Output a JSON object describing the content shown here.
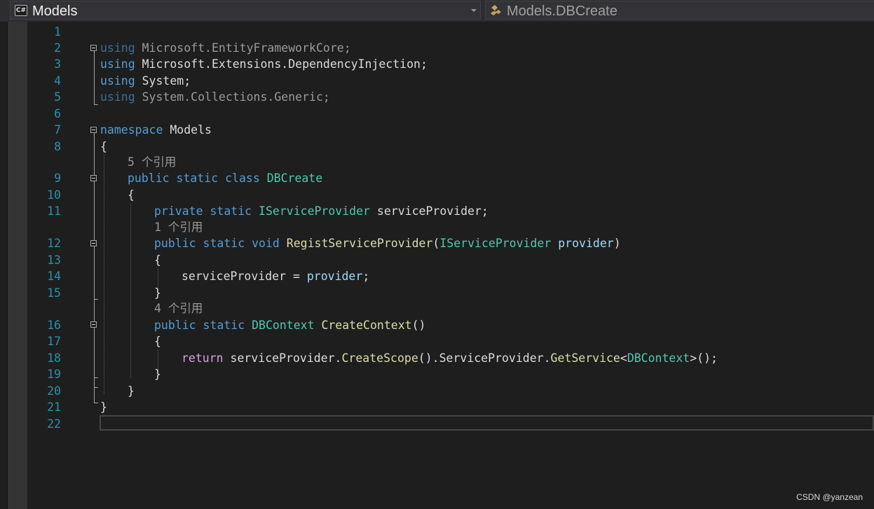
{
  "navbar": {
    "project_icon": "csharp-project-icon",
    "project": "Models",
    "type_icon": "class-icon",
    "type": "Models.DBCreate"
  },
  "editor": {
    "line_numbers": [
      "1",
      "2",
      "3",
      "4",
      "5",
      "6",
      "7",
      "8",
      "9",
      "10",
      "11",
      "12",
      "13",
      "14",
      "15",
      "16",
      "17",
      "18",
      "19",
      "20",
      "21",
      "22"
    ],
    "code": {
      "l2": {
        "kw": "using",
        "ns": "Microsoft.EntityFrameworkCore;"
      },
      "l3": {
        "kw": "using",
        "ns": "Microsoft.Extensions.DependencyInjection;"
      },
      "l4": {
        "kw": "using",
        "ns": "System;"
      },
      "l5": {
        "kw": "using",
        "ns": "System.Collections.Generic;"
      },
      "l7": {
        "kw": "namespace",
        "ns": "Models"
      },
      "l8": {
        "text": "{"
      },
      "lens1": {
        "count": "5",
        "label": "个引用"
      },
      "l9": {
        "kw1": "public",
        "kw2": "static",
        "kw3": "class",
        "name": "DBCreate"
      },
      "l10": {
        "text": "{"
      },
      "l11": {
        "kw1": "private",
        "kw2": "static",
        "type": "IServiceProvider",
        "rest": "serviceProvider;"
      },
      "lens2": {
        "count": "1",
        "label": "个引用"
      },
      "l12": {
        "kw1": "public",
        "kw2": "static",
        "kw3": "void",
        "method": "RegistServiceProvider",
        "open": "(",
        "ptype": "IServiceProvider",
        "param": "provider",
        "close": ")"
      },
      "l13": {
        "text": "{"
      },
      "l14": {
        "target": "serviceProvider",
        "op": " = ",
        "value": "provider",
        "end": ";"
      },
      "l15": {
        "text": "}"
      },
      "lens3": {
        "count": "4",
        "label": "个引用"
      },
      "l16": {
        "kw1": "public",
        "kw2": "static",
        "type": "DBContext",
        "method": "CreateContext",
        "rest": "()"
      },
      "l17": {
        "text": "{"
      },
      "l18": {
        "ret": "return",
        "a": "serviceProvider.",
        "m1": "CreateScope",
        "b": "().ServiceProvider.",
        "m2": "GetService",
        "lt": "<",
        "gt": "DBContext",
        "c": ">();"
      },
      "l19": {
        "text": "}"
      },
      "l20": {
        "text": "}"
      },
      "l21": {
        "text": "}"
      }
    }
  },
  "watermark": "CSDN @yanzean"
}
